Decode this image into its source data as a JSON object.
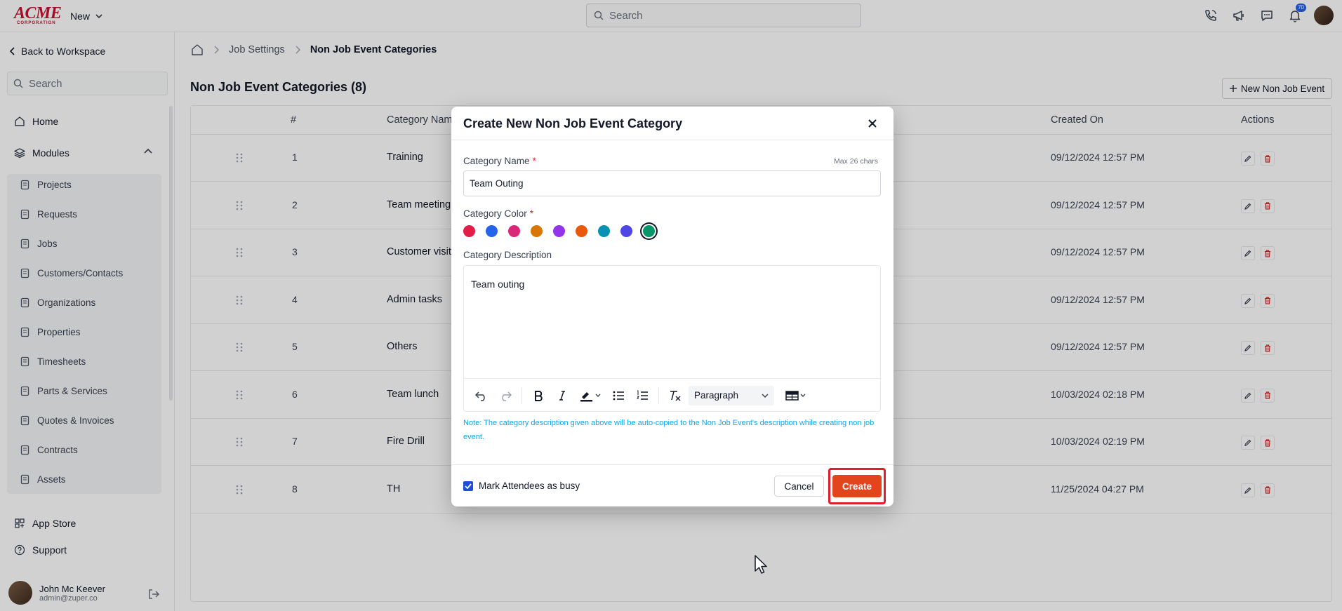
{
  "brand": {
    "logo_main": "ACME",
    "logo_sub": "CORPORATION"
  },
  "topbar": {
    "new_label": "New",
    "search_placeholder": "Search",
    "notification_count": "70"
  },
  "sidebar": {
    "back_label": "Back to Workspace",
    "search_placeholder": "Search",
    "home_label": "Home",
    "modules_label": "Modules",
    "modules": [
      "Projects",
      "Requests",
      "Jobs",
      "Customers/Contacts",
      "Organizations",
      "Properties",
      "Timesheets",
      "Parts & Services",
      "Quotes & Invoices",
      "Contracts",
      "Assets"
    ],
    "app_store_label": "App Store",
    "support_label": "Support",
    "user_name": "John Mc Keever",
    "user_email": "admin@zuper.co"
  },
  "breadcrumb": {
    "item1": "Job Settings",
    "current": "Non Job Event Categories"
  },
  "page": {
    "title": "Non Job Event Categories (8)",
    "new_button": "New Non Job Event"
  },
  "table": {
    "headers": {
      "num": "#",
      "name": "Category Nam",
      "created": "Created On",
      "actions": "Actions"
    },
    "rows": [
      {
        "num": "1",
        "name": "Training",
        "created": "09/12/2024 12:57 PM"
      },
      {
        "num": "2",
        "name": "Team meeting",
        "created": "09/12/2024 12:57 PM"
      },
      {
        "num": "3",
        "name": "Customer visit",
        "created": "09/12/2024 12:57 PM"
      },
      {
        "num": "4",
        "name": "Admin tasks",
        "created": "09/12/2024 12:57 PM"
      },
      {
        "num": "5",
        "name": "Others",
        "created": "09/12/2024 12:57 PM"
      },
      {
        "num": "6",
        "name": "Team lunch",
        "created": "10/03/2024 02:18 PM"
      },
      {
        "num": "7",
        "name": "Fire Drill",
        "created": "10/03/2024 02:19 PM"
      },
      {
        "num": "8",
        "name": "TH",
        "created": "11/25/2024 04:27 PM"
      }
    ]
  },
  "modal": {
    "title": "Create New Non Job Event Category",
    "name_label": "Category Name",
    "required_mark": "*",
    "max_chars": "Max 26 chars",
    "name_value": "Team Outing",
    "color_label": "Category Color",
    "colors": [
      "#e11d48",
      "#2563eb",
      "#db2777",
      "#d97706",
      "#9333ea",
      "#ea580c",
      "#0891b2",
      "#4f46e5",
      "#059669"
    ],
    "selected_color_index": 8,
    "description_label": "Category Description",
    "description_value": "Team outing",
    "paragraph_option": "Paragraph",
    "note": "Note: The category description given above will be auto-copied to the Non Job Event's description while creating non job event.",
    "mark_busy_label": "Mark Attendees as busy",
    "mark_busy_checked": true,
    "cancel_label": "Cancel",
    "create_label": "Create"
  }
}
